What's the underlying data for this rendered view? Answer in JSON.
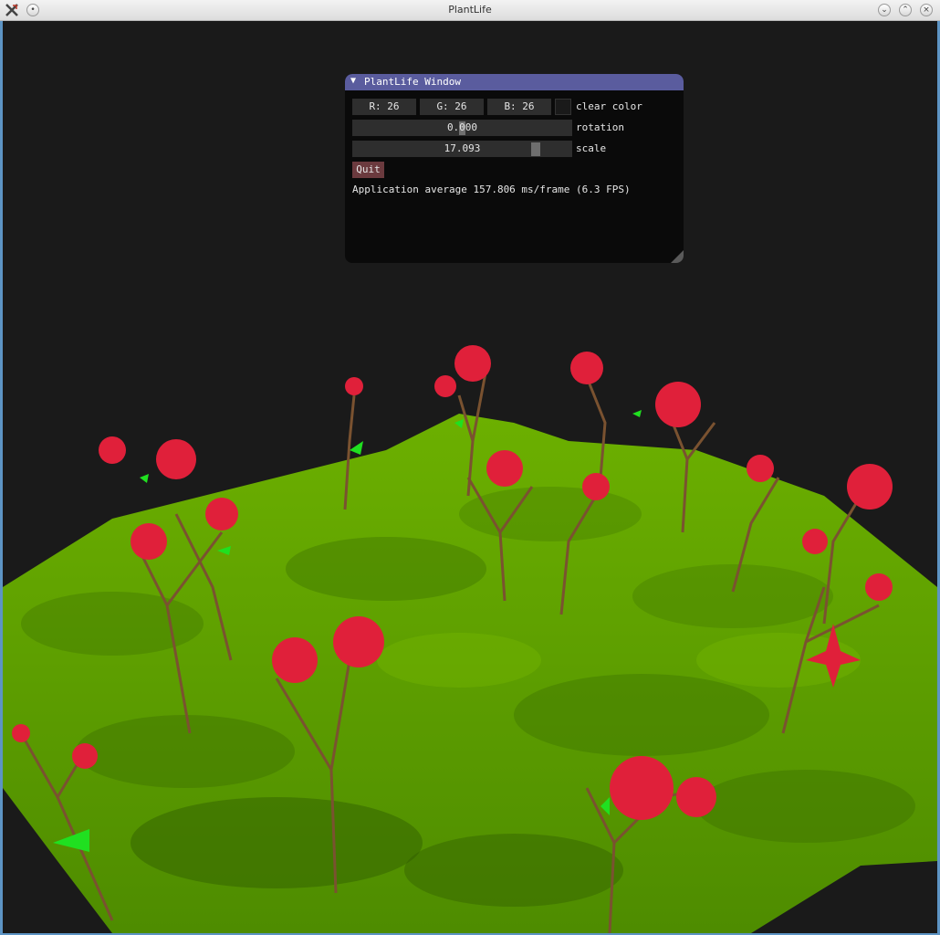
{
  "window": {
    "title": "PlantLife",
    "buttons": [
      "minimize",
      "maximize",
      "close"
    ]
  },
  "imgui": {
    "title": "PlantLife Window",
    "color": {
      "r_label": "R: 26",
      "g_label": "G: 26",
      "b_label": "B: 26",
      "swatch_color": "#1a1a1a",
      "label": "clear color"
    },
    "rotation": {
      "value": "0.000",
      "label": "rotation",
      "fraction": 0.5
    },
    "scale": {
      "value": "17.093",
      "label": "scale",
      "fraction": 0.85
    },
    "quit_label": "Quit",
    "fps_text": "Application average 157.806 ms/frame (6.3 FPS)"
  },
  "colors": {
    "background": "#1a1a1a",
    "terrain": "#5ea500",
    "trunk": "#7a5230",
    "flower": "#e0203a",
    "leaf": "#20e020",
    "imgui_header": "#5a5c9e",
    "quit_button": "#6b3a3e"
  },
  "scene": {
    "description_icon": "terrain-with-trees"
  }
}
